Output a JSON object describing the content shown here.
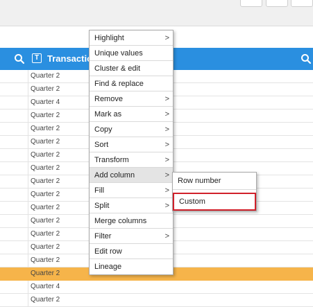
{
  "header": {
    "column_title": "Transactio"
  },
  "rows": [
    "Quarter 2",
    "Quarter 2",
    "Quarter 4",
    "Quarter 2",
    "Quarter 2",
    "Quarter 2",
    "Quarter 2",
    "Quarter 2",
    "Quarter 2",
    "Quarter 2",
    "Quarter 2",
    "Quarter 2",
    "Quarter 2",
    "Quarter 2",
    "Quarter 2",
    "Quarter 2",
    "Quarter 4",
    "Quarter 2"
  ],
  "selected_row_index": 15,
  "context_menu": {
    "items": [
      {
        "label": "Highlight",
        "arrow": ">"
      },
      {
        "label": "Unique values",
        "arrow": ""
      },
      {
        "label": "Cluster & edit",
        "arrow": ""
      },
      {
        "label": "Find & replace",
        "arrow": ""
      },
      {
        "label": "Remove",
        "arrow": ">"
      },
      {
        "label": "Mark as",
        "arrow": ">"
      },
      {
        "label": "Copy",
        "arrow": ">"
      },
      {
        "label": "Sort",
        "arrow": ">"
      },
      {
        "label": "Transform",
        "arrow": ">"
      },
      {
        "label": "Add column",
        "arrow": ">"
      },
      {
        "label": "Fill",
        "arrow": ">"
      },
      {
        "label": "Split",
        "arrow": ">"
      },
      {
        "label": "Merge columns",
        "arrow": ""
      },
      {
        "label": "Filter",
        "arrow": ">"
      },
      {
        "label": "Edit row",
        "arrow": ""
      },
      {
        "label": "Lineage",
        "arrow": ""
      }
    ],
    "active_item": "Add column"
  },
  "submenu": {
    "items": [
      {
        "label": "Row number"
      },
      {
        "label": "Custom"
      }
    ],
    "highlighted_item": "Custom"
  },
  "colors": {
    "header_bg": "#2a8fe0",
    "selected_row": "#f6b44a",
    "highlight_border": "#d0202a"
  },
  "icons": [
    "search-icon",
    "text-type-icon",
    "search-icon"
  ]
}
